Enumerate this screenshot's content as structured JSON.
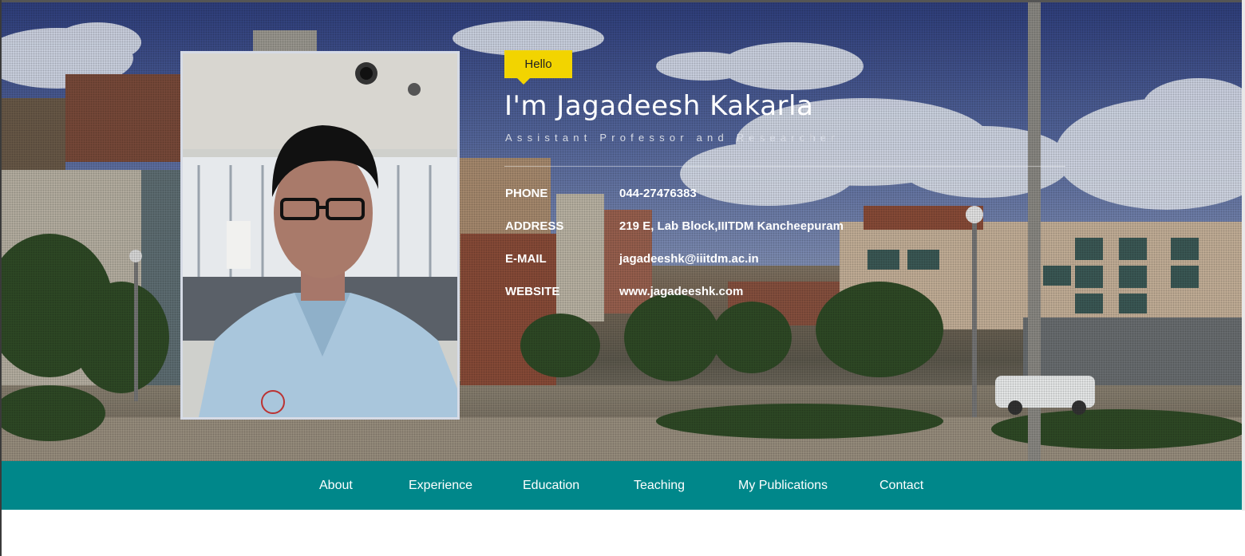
{
  "hero": {
    "greeting": "Hello",
    "name": "I'm Jagadeesh Kakarla",
    "subtitle": "Assistant Professor and Researcher",
    "contact": [
      {
        "label": "PHONE",
        "value": "044-27476383"
      },
      {
        "label": "ADDRESS",
        "value": "219 E, Lab Block,IIITDM Kancheepuram"
      },
      {
        "label": "E-MAIL",
        "value": "jagadeeshk@iiitdm.ac.in"
      },
      {
        "label": "WEBSITE",
        "value": "www.jagadeeshk.com"
      }
    ]
  },
  "nav": {
    "items": [
      {
        "label": "About"
      },
      {
        "label": "Experience"
      },
      {
        "label": "Education"
      },
      {
        "label": "Teaching"
      },
      {
        "label": "My Publications"
      },
      {
        "label": "Contact"
      }
    ]
  },
  "colors": {
    "nav_background": "#00878a",
    "badge": "#f2d400",
    "text": "#ffffff"
  }
}
